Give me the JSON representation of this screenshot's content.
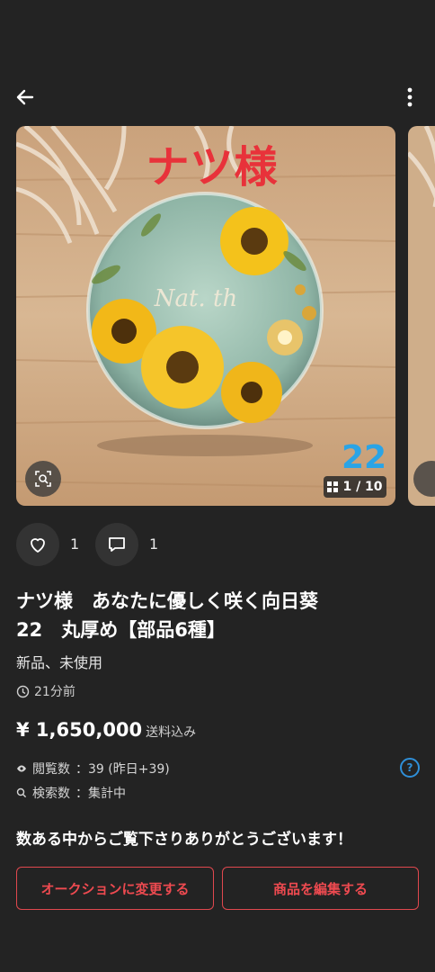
{
  "header": {
    "back_icon": "arrow-left-icon",
    "menu_icon": "more-vertical-icon"
  },
  "gallery": {
    "overlay_name": "ナツ様",
    "overlay_number": "22",
    "counter": "1 / 10",
    "counter_icon": "grid-icon",
    "lens_icon": "image-search-icon"
  },
  "engagement": {
    "likes": "1",
    "comments": "1"
  },
  "item": {
    "title_line1": "ナツ様　あなたに優しく咲く向日葵",
    "title_line2": "22　丸厚め【部品6種】",
    "condition": "新品、未使用",
    "posted": "21分前",
    "price": "¥ 1,650,000",
    "price_note": "送料込み",
    "views_label": "閲覧数",
    "views_value": "：39 (昨日+39)",
    "search_label": "検索数",
    "search_value": "：集計中",
    "message": "数ある中からご覧下さりありがとうございます！"
  },
  "buttons": {
    "auction": "オークションに変更する",
    "edit": "商品を編集する"
  },
  "colors": {
    "background": "#232323",
    "accent_red": "#e0484e",
    "help_blue": "#2f8fd8"
  }
}
